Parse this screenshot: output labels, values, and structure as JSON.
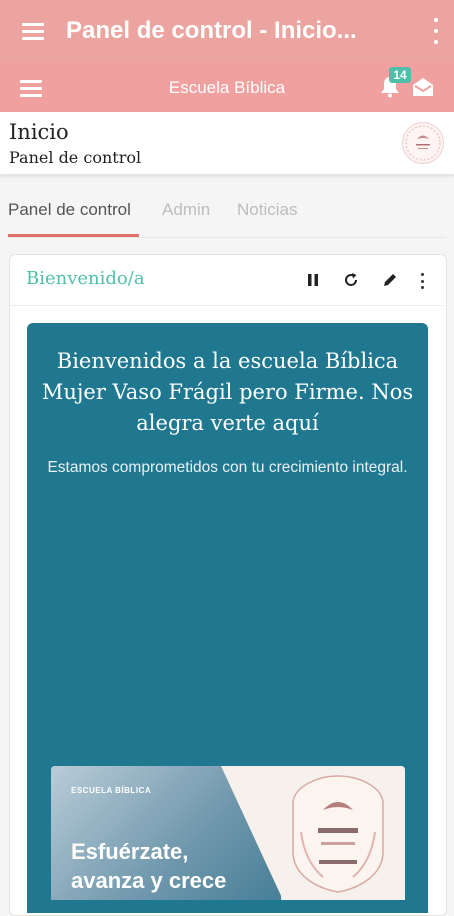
{
  "appbar": {
    "title": "Panel de control - Inicio..."
  },
  "sitebar": {
    "title": "Escuela Bíblica",
    "notifications": "14"
  },
  "header": {
    "title": "Inicio",
    "subtitle": "Panel de control"
  },
  "tabs": [
    {
      "label": "Panel de control"
    },
    {
      "label": "Admin"
    },
    {
      "label": "Noticias"
    }
  ],
  "card": {
    "title": "Bienvenido/a",
    "heading": "Bienvenidos a la escuela Bíblica Mujer Vaso Frágil pero Firme. Nos alegra verte aquí",
    "text": "Estamos comprometidos con tu crecimiento integral.",
    "banner": {
      "kicker": "ESCUELA BÍBLICA",
      "slogan_line1": "Esfuérzate,",
      "slogan_line2": "avanza y crece"
    }
  },
  "colors": {
    "appbar": "#eba49f",
    "sitebar": "#f1a0a0",
    "accent": "#4fbfaa",
    "tab_active": "#e0726c",
    "slide": "#1f7890"
  },
  "icons": [
    "menu-icon",
    "more-vert-icon",
    "bell-icon",
    "envelope-icon",
    "pause-icon",
    "refresh-icon",
    "pencil-icon",
    "school-logo"
  ]
}
